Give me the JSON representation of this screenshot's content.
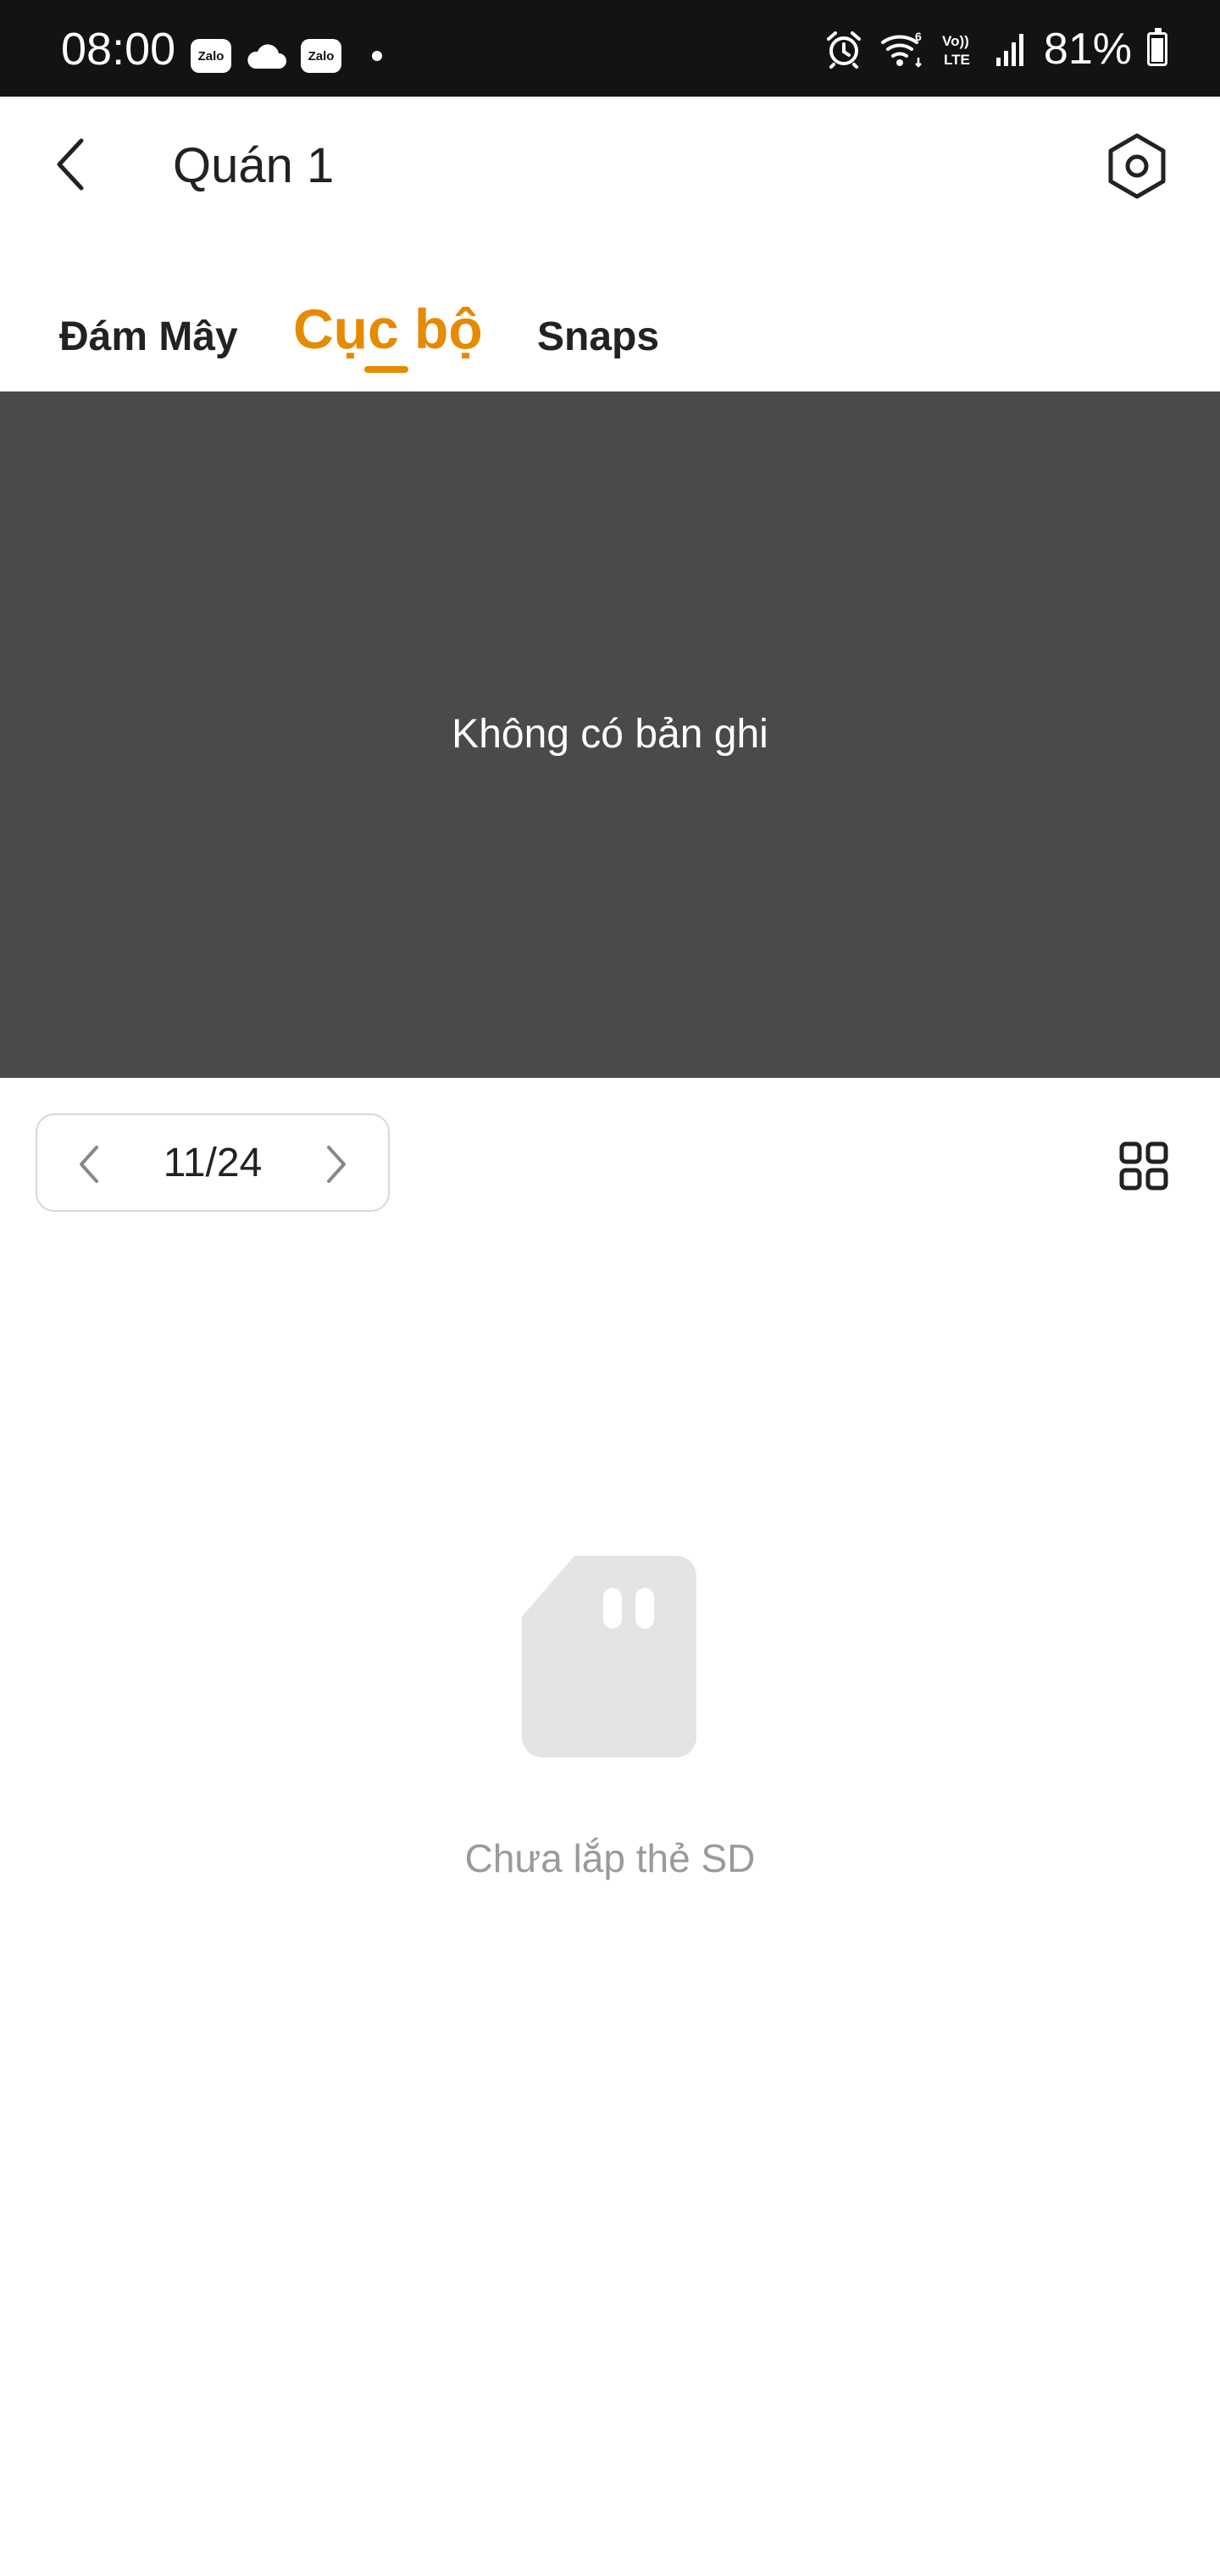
{
  "status_bar": {
    "time": "08:00",
    "notifications": [
      {
        "icon": "zalo-icon",
        "label": "Zalo"
      },
      {
        "icon": "cloud-icon"
      },
      {
        "icon": "zalo-icon",
        "label": "Zalo"
      },
      {
        "icon": "dot-icon"
      }
    ],
    "right_icons": [
      "alarm-icon",
      "wifi-6-icon",
      "volte-icon",
      "signal-icon"
    ],
    "volte_label_top": "Vo))",
    "volte_label_bottom": "LTE",
    "battery_text": "81%",
    "battery_level": 0.81
  },
  "header": {
    "title": "Quán 1",
    "back_icon": "chevron-left-icon",
    "settings_icon": "settings-hexagon-icon"
  },
  "tabs": [
    {
      "label": "Đám Mây",
      "active": false
    },
    {
      "label": "Cục bộ",
      "active": true
    },
    {
      "label": "Snaps",
      "active": false
    }
  ],
  "player": {
    "message": "Không có bản ghi"
  },
  "pager": {
    "label": "11/24",
    "prev_icon": "chevron-left-icon",
    "next_icon": "chevron-right-icon"
  },
  "view_toggle_icon": "grid-icon",
  "empty_state": {
    "icon": "sd-card-icon",
    "message": "Chưa lắp thẻ SD"
  },
  "colors": {
    "status_bar_bg": "#131313",
    "accent": "#e68a00",
    "player_bg": "#4a4a4a",
    "muted_text": "#9a9a9a",
    "sd_icon": "#e4e4e4"
  }
}
